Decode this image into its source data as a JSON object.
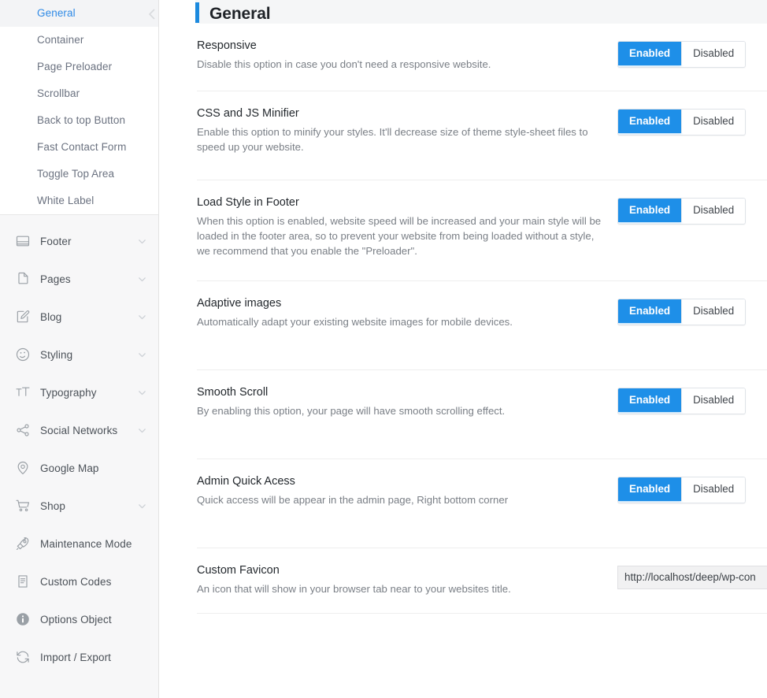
{
  "sidebar": {
    "collapse_icon": "chevron-left-icon",
    "submenu": [
      {
        "label": "General",
        "active": true
      },
      {
        "label": "Container",
        "active": false
      },
      {
        "label": "Page Preloader",
        "active": false
      },
      {
        "label": "Scrollbar",
        "active": false
      },
      {
        "label": "Back to top Button",
        "active": false
      },
      {
        "label": "Fast Contact Form",
        "active": false
      },
      {
        "label": "Toggle Top Area",
        "active": false
      },
      {
        "label": "White Label",
        "active": false
      }
    ],
    "menu": [
      {
        "label": "Footer",
        "icon": "footer-layout-icon",
        "expandable": true
      },
      {
        "label": "Pages",
        "icon": "pages-file-icon",
        "expandable": true
      },
      {
        "label": "Blog",
        "icon": "blog-pencil-icon",
        "expandable": true
      },
      {
        "label": "Styling",
        "icon": "styling-palette-icon",
        "expandable": true
      },
      {
        "label": "Typography",
        "icon": "typography-tt-icon",
        "expandable": true
      },
      {
        "label": "Social Networks",
        "icon": "share-nodes-icon",
        "expandable": true
      },
      {
        "label": "Google Map",
        "icon": "map-pin-icon",
        "expandable": false
      },
      {
        "label": "Shop",
        "icon": "shopping-cart-icon",
        "expandable": true
      },
      {
        "label": "Maintenance Mode",
        "icon": "rocket-icon",
        "expandable": false
      },
      {
        "label": "Custom Codes",
        "icon": "code-document-icon",
        "expandable": false
      },
      {
        "label": "Options Object",
        "icon": "info-circle-icon",
        "expandable": false
      },
      {
        "label": "Import / Export",
        "icon": "refresh-sync-icon",
        "expandable": false
      }
    ]
  },
  "header": {
    "title": "General",
    "accent_color": "#1c8ade"
  },
  "toggle_labels": {
    "enabled": "Enabled",
    "disabled": "Disabled"
  },
  "settings": [
    {
      "title": "Responsive",
      "desc": "Disable this option in case you don't need a responsive website.",
      "control": "toggle",
      "value": "Enabled"
    },
    {
      "title": "CSS and JS Minifier",
      "desc": "Enable this option to minify your styles. It'll decrease size of theme style-sheet files to speed up your website.",
      "control": "toggle",
      "value": "Enabled"
    },
    {
      "title": "Load Style in Footer",
      "desc": "When this option is enabled, website speed will be increased and your main style will be loaded in the footer area, so to prevent your website from being loaded without a style, we recommend that you enable the \"Preloader\".",
      "control": "toggle",
      "value": "Enabled"
    },
    {
      "title": "Adaptive images",
      "desc": "Automatically adapt your existing website images for mobile devices.",
      "control": "toggle",
      "value": "Enabled"
    },
    {
      "title": "Smooth Scroll",
      "desc": "By enabling this option, your page will have smooth scrolling effect.",
      "control": "toggle",
      "value": "Enabled"
    },
    {
      "title": "Admin Quick Acess",
      "desc": "Quick access will be appear in the admin page, Right bottom corner",
      "control": "toggle",
      "value": "Enabled"
    },
    {
      "title": "Custom Favicon",
      "desc": "An icon that will show in your browser tab near to your websites title.",
      "control": "text",
      "value": "http://localhost/deep/wp-con",
      "placeholder": ""
    }
  ],
  "colors": {
    "accent_blue": "#1e8fe8",
    "sidebar_bg": "#f7f7f8",
    "header_bg": "#f5f6f7",
    "active_text": "#2e8ae6"
  }
}
